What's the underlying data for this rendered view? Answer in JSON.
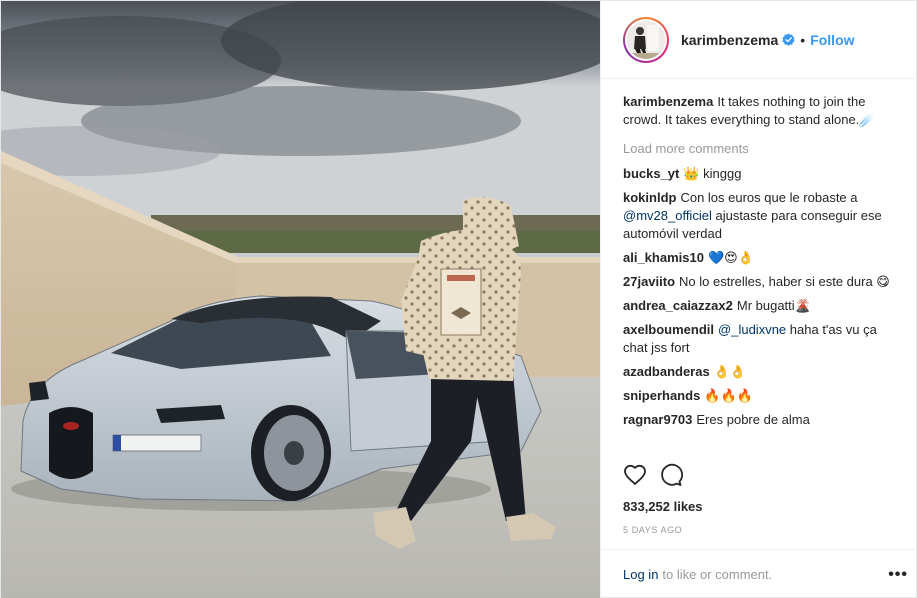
{
  "post": {
    "username": "karimbenzema",
    "follow_label": "Follow",
    "separator": "•",
    "caption": "It takes nothing to join the crowd. It takes everything to stand alone.☄️",
    "load_more": "Load more comments",
    "likes": "833,252 likes",
    "time": "5 DAYS AGO"
  },
  "comments": [
    {
      "user": "bucks_yt",
      "text": "👑 kinggg"
    },
    {
      "user": "kokinldp",
      "text_before": "Con los euros que le robaste a",
      "mention": "@mv28_officiel",
      "text_after": "ajustaste para conseguir ese automóvil verdad"
    },
    {
      "user": "ali_khamis10",
      "text": "💙😍👌"
    },
    {
      "user": "27javiito",
      "text": "No lo estrelles, haber si este dura 😋"
    },
    {
      "user": "andrea_caiazzax2",
      "text": "Mr bugatti🌋"
    },
    {
      "user": "axelboumendil",
      "mention": "@_ludixvne",
      "text_after": "haha t'as vu ça chat jss fort"
    },
    {
      "user": "azadbanderas",
      "text": "👌👌"
    },
    {
      "user": "sniperhands",
      "text": "🔥🔥🔥"
    },
    {
      "user": "ragnar9703",
      "text": "Eres pobre de alma"
    }
  ],
  "footer": {
    "login_label": "Log in",
    "login_rest": "to like or comment.",
    "more_label": "•••"
  },
  "icons": {
    "verified": "verified-badge-icon",
    "like": "heart-icon",
    "comment": "comment-bubble-icon",
    "more": "more-options-icon"
  },
  "colors": {
    "link": "#3897f0",
    "mention": "#003569",
    "muted": "#999999"
  }
}
